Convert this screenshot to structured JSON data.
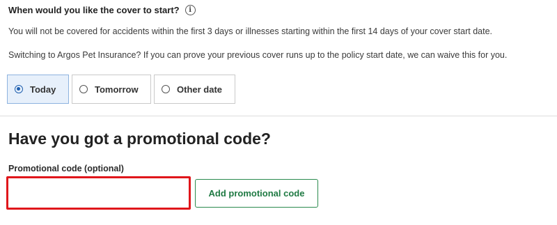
{
  "cover_start": {
    "question": "When would you like the cover to start?",
    "info_icon": "i",
    "note_1": "You will not be covered for accidents within the first 3 days or illnesses starting within the first 14 days of your cover start date.",
    "note_2": "Switching to Argos Pet Insurance? If you can prove your previous cover runs up to the policy start date, we can waive this for you.",
    "options": [
      {
        "label": "Today",
        "selected": true
      },
      {
        "label": "Tomorrow",
        "selected": false
      },
      {
        "label": "Other date",
        "selected": false
      }
    ]
  },
  "promo": {
    "heading": "Have you got a promotional code?",
    "field_label": "Promotional code (optional)",
    "field_value": "",
    "button_label": "Add promotional code"
  },
  "colors": {
    "selected_bg": "#e7f0fb",
    "radio_accent": "#1f5fae",
    "input_highlight": "#e0161b",
    "button_green": "#2a8a4d"
  }
}
